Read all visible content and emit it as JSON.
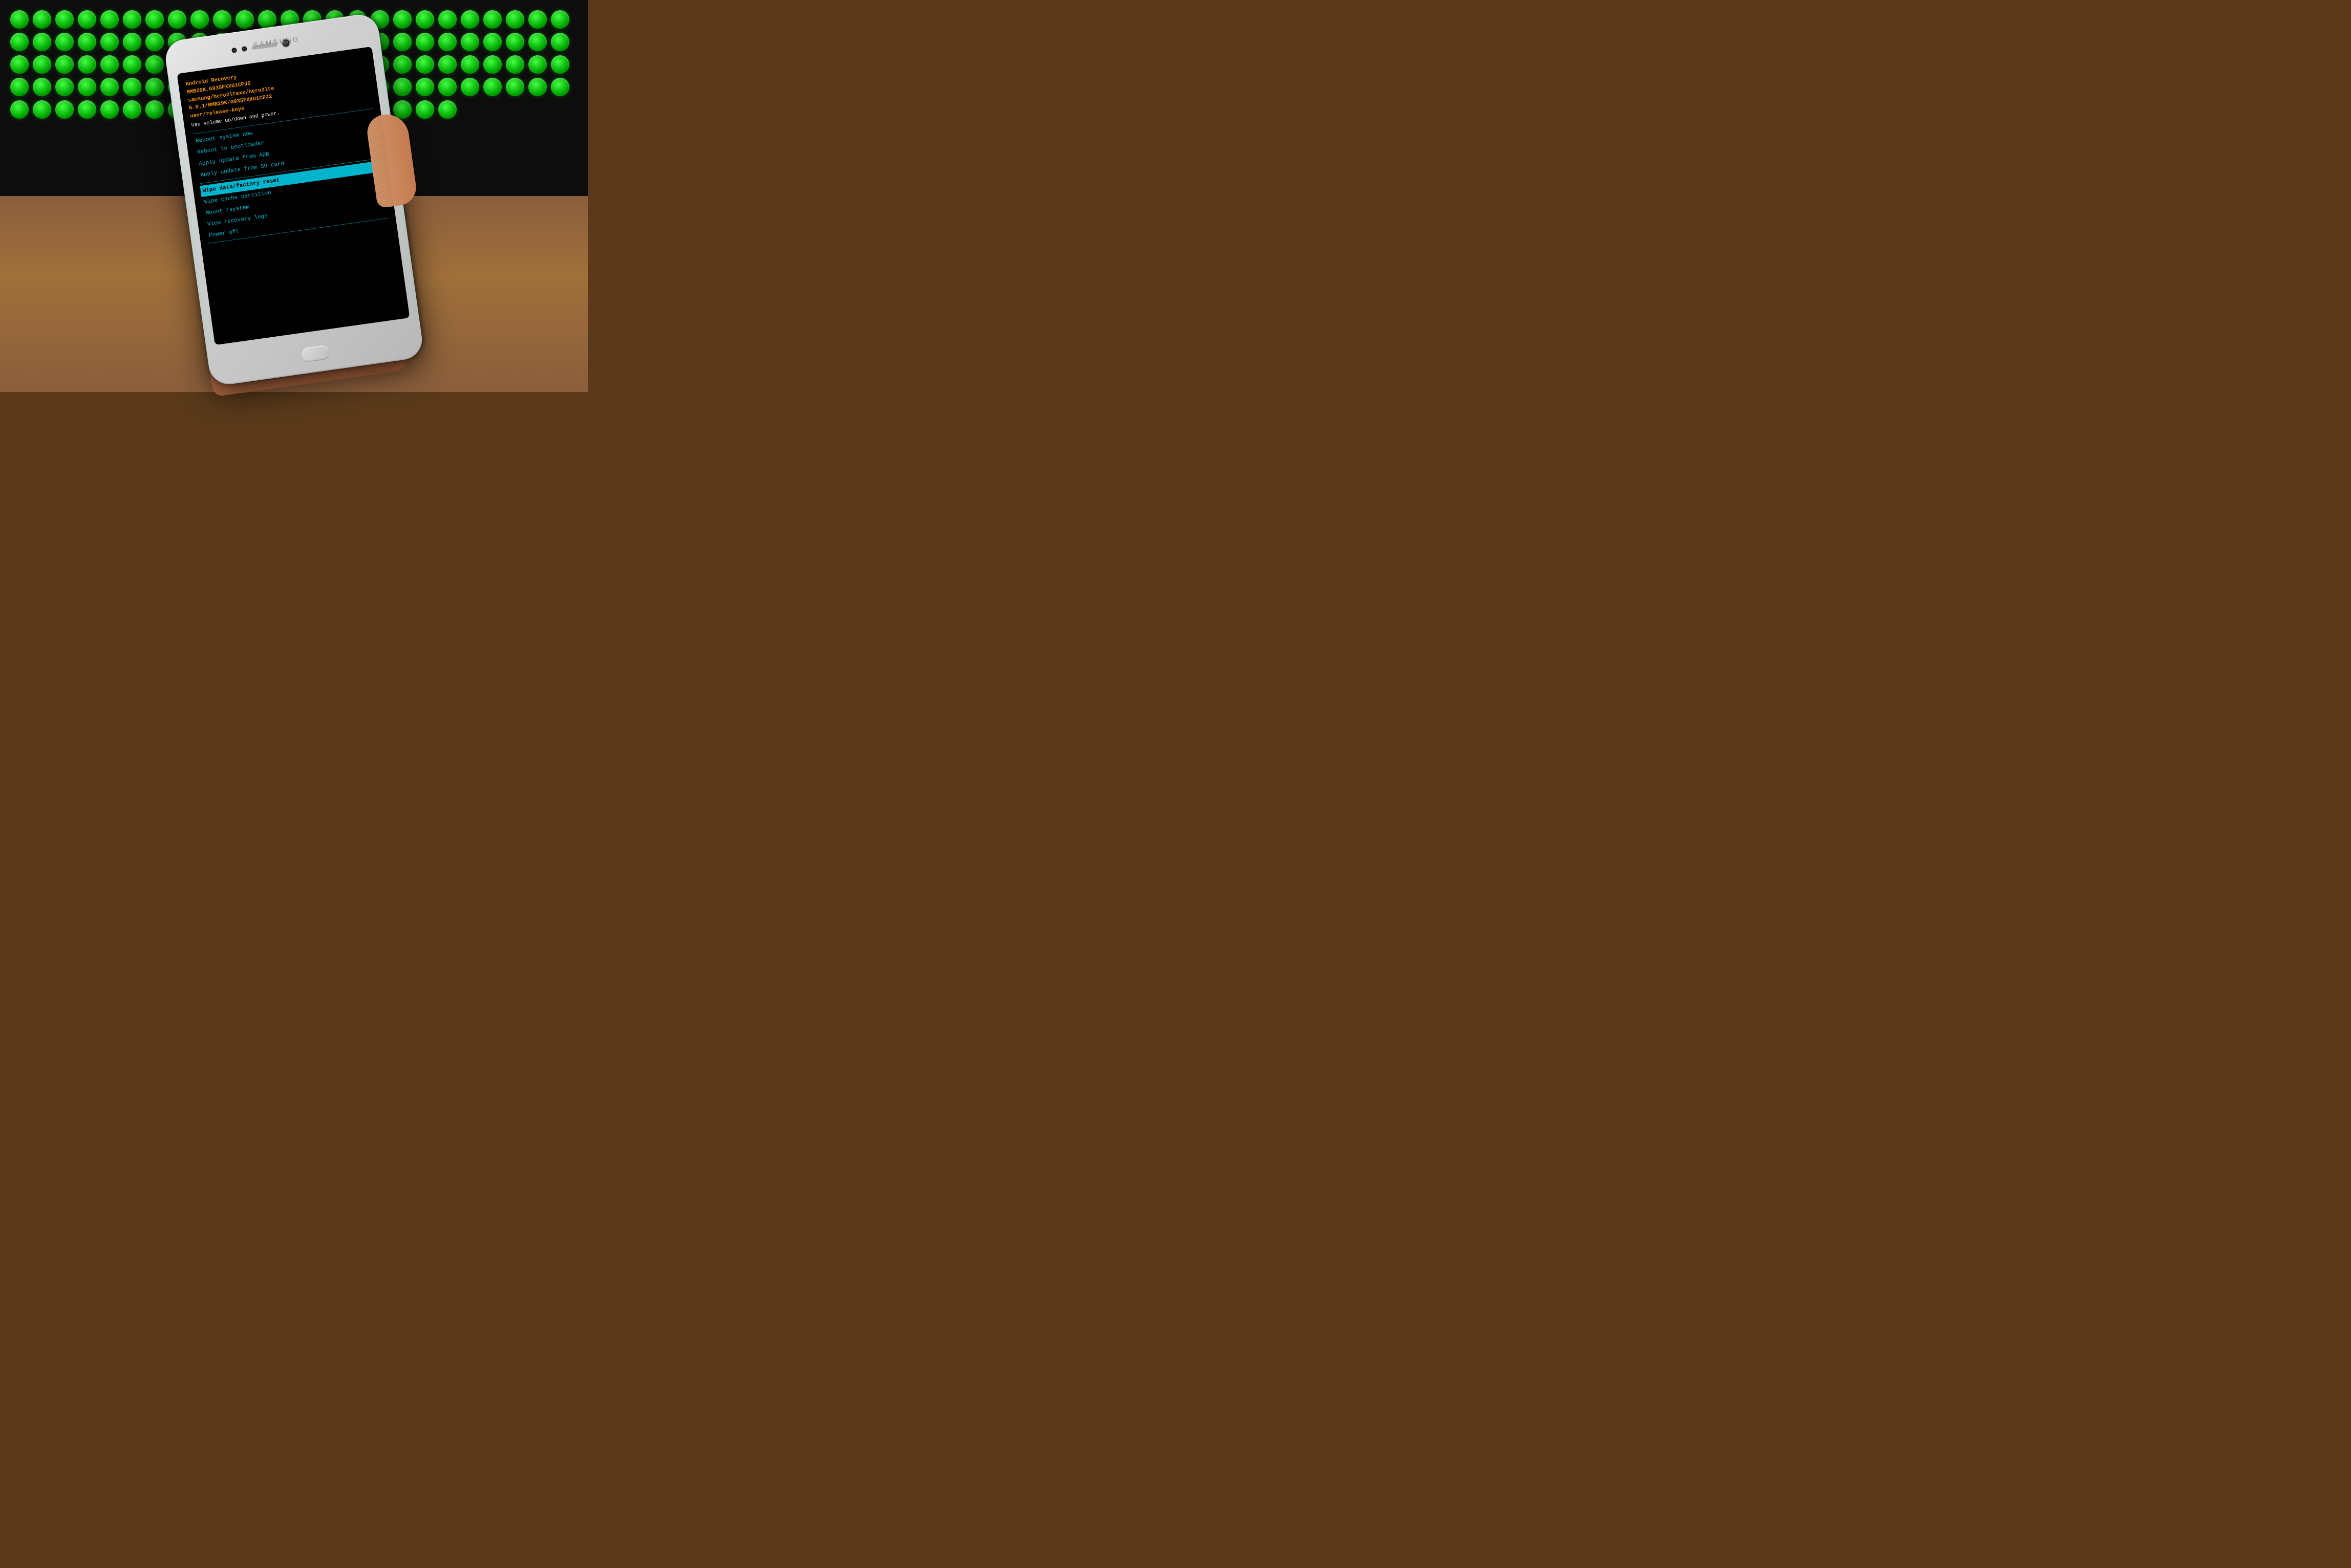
{
  "background": {
    "keyboard_color": "#0d1a0d",
    "desk_color": "#8b5e3c"
  },
  "phone": {
    "brand": "SAMSUNG",
    "brand_color": "#888888"
  },
  "recovery": {
    "title_line1": "Android Recovery",
    "title_line2": "MMB29K.G935FXXU1CPJ2",
    "title_line3": "samsung/hero2ltexx/hero2lte",
    "title_line4": "6.0.1/MMB29K/G935FXXU1CPJ2",
    "title_line5": "user/release-keys",
    "instruction": "Use volume up/down and power.",
    "divider1": "",
    "menu_items": [
      {
        "label": "Reboot system now",
        "selected": false
      },
      {
        "label": "Reboot to bootloader",
        "selected": false
      },
      {
        "label": "Apply update from ADB",
        "selected": false
      },
      {
        "label": "Apply update from SD card",
        "selected": false
      },
      {
        "label": "Wipe data/factory reset",
        "selected": true
      },
      {
        "label": "Wipe cache partition",
        "selected": false
      },
      {
        "label": "Mount /system",
        "selected": false
      },
      {
        "label": "View recovery logs",
        "selected": false
      },
      {
        "label": "Power off",
        "selected": false
      }
    ]
  }
}
